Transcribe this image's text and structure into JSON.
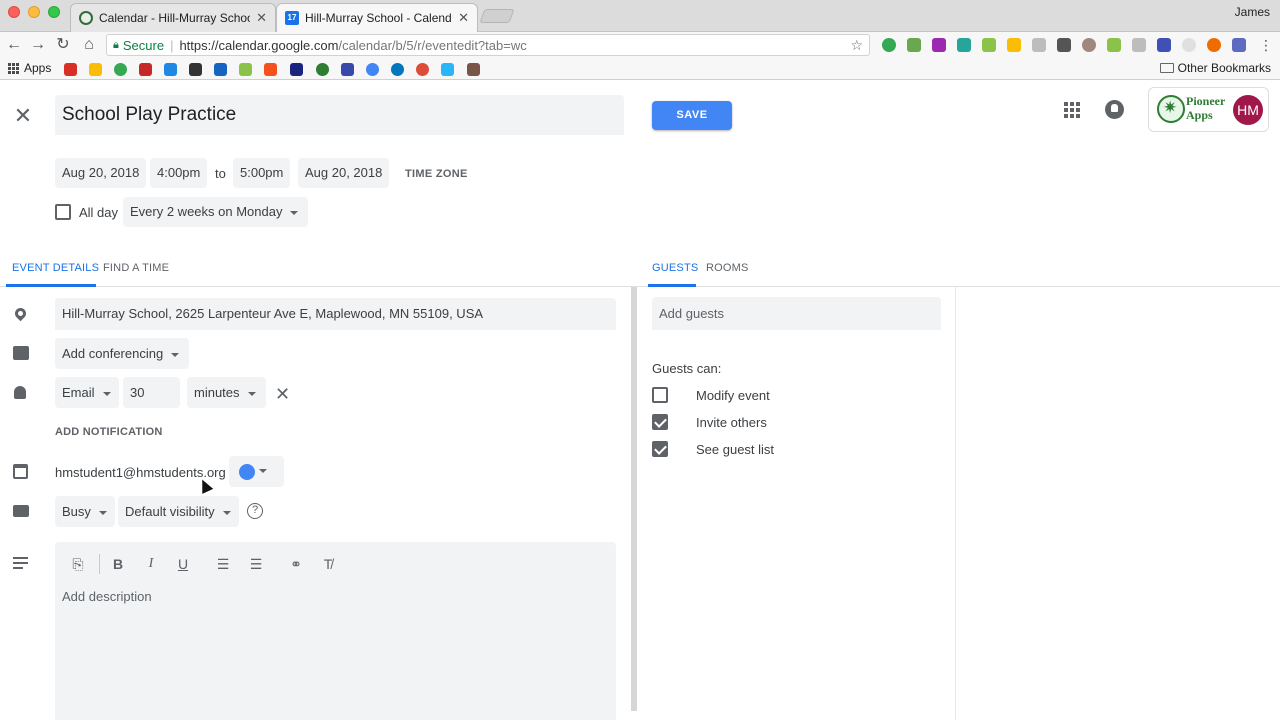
{
  "browser": {
    "tabs": [
      {
        "title": "Calendar - Hill-Murray School"
      },
      {
        "title": "Hill-Murray School - Calendar",
        "icon_label": "17"
      }
    ],
    "profile": "James",
    "secure_label": "Secure",
    "url_host": "https://calendar.google.com",
    "url_path": "/calendar/b/5/r/eventedit?tab=wc",
    "bookmarks_apps": "Apps",
    "other_bookmarks": "Other Bookmarks"
  },
  "event": {
    "title": "School Play Practice",
    "save_label": "SAVE",
    "start_date": "Aug 20, 2018",
    "start_time": "4:00pm",
    "to_label": "to",
    "end_time": "5:00pm",
    "end_date": "Aug 20, 2018",
    "time_zone_label": "TIME ZONE",
    "all_day_label": "All day",
    "all_day_checked": false,
    "recurrence": "Every 2 weeks on Monday"
  },
  "account": {
    "org_logo_text_line1": "Pioneer",
    "org_logo_text_line2": "Apps",
    "avatar_initials": "HM"
  },
  "tabs": {
    "event_details": "EVENT DETAILS",
    "find_a_time": "FIND A TIME",
    "guests": "GUESTS",
    "rooms": "ROOMS"
  },
  "details": {
    "location": "Hill-Murray School, 2625 Larpenteur Ave E, Maplewood, MN 55109, USA",
    "conferencing": "Add conferencing",
    "notification_type": "Email",
    "notification_value": "30",
    "notification_unit": "minutes",
    "add_notification": "ADD NOTIFICATION",
    "calendar_owner": "hmstudent1@hmstudents.org",
    "calendar_color": "#4285f4",
    "availability": "Busy",
    "visibility": "Default visibility",
    "description_placeholder": "Add description"
  },
  "guests": {
    "placeholder": "Add guests",
    "guests_can_label": "Guests can:",
    "permissions": [
      {
        "label": "Modify event",
        "checked": false
      },
      {
        "label": "Invite others",
        "checked": true
      },
      {
        "label": "See guest list",
        "checked": true
      }
    ]
  },
  "colors": {
    "accent": "#1a73e8",
    "save_button": "#4285f4",
    "avatar": "#a0184a"
  }
}
